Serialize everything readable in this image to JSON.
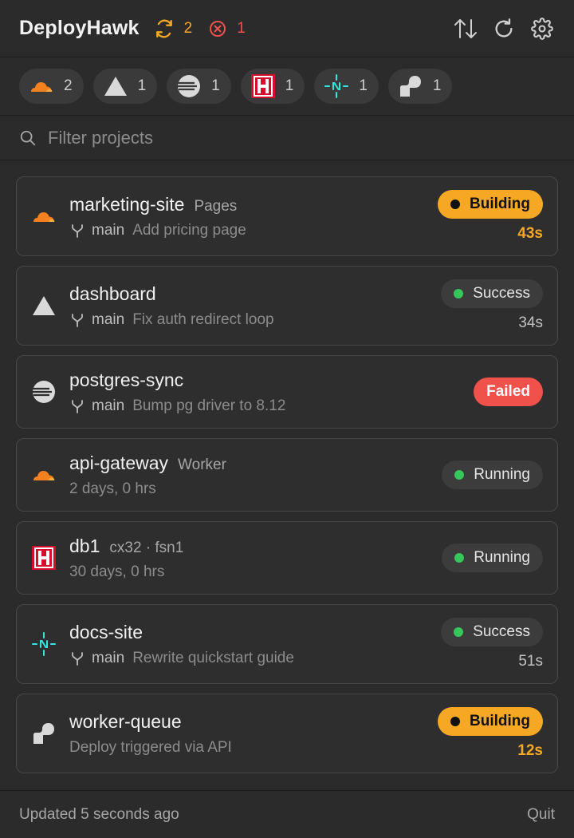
{
  "header": {
    "title": "DeployHawk",
    "building_count": "2",
    "failed_count": "1",
    "icons": [
      "sync-icon",
      "failed-icon",
      "sort-icon",
      "refresh-icon",
      "gear-icon"
    ]
  },
  "providers": [
    {
      "name": "cloudflare",
      "count": "1",
      "color": "#f48120"
    },
    {
      "name": "vercel",
      "count": "1",
      "color": "#d9d9d9"
    },
    {
      "name": "railway",
      "count": "1",
      "color": "#d9d9d9"
    },
    {
      "name": "hetzner",
      "count": "1",
      "color": "#d50c2d"
    },
    {
      "name": "netlify",
      "count": "1",
      "color": "#32e6e2"
    },
    {
      "name": "render",
      "count": "1",
      "color": "#d9d9d9"
    }
  ],
  "provider_counts": [
    "2",
    "1",
    "1",
    "1",
    "1",
    "1"
  ],
  "search": {
    "placeholder": "Filter projects"
  },
  "projects": [
    {
      "name": "marketing-site",
      "tag": "Pages",
      "branch": "main",
      "message": "Add pricing page",
      "status": "Building",
      "duration": "43s"
    },
    {
      "name": "dashboard",
      "tag": "",
      "branch": "main",
      "message": "Fix auth redirect loop",
      "status": "Success",
      "duration": "34s"
    },
    {
      "name": "postgres-sync",
      "tag": "",
      "branch": "main",
      "message": "Bump pg driver to 8.12",
      "status": "Failed",
      "duration": ""
    },
    {
      "name": "api-gateway",
      "tag": "Worker",
      "branch": "",
      "message": "2 days, 0 hrs",
      "status": "Running",
      "duration": ""
    },
    {
      "name": "db1",
      "tag": "cx32 · fsn1",
      "branch": "",
      "message": "30 days, 0 hrs",
      "status": "Running",
      "duration": ""
    },
    {
      "name": "docs-site",
      "tag": "",
      "branch": "main",
      "message": "Rewrite quickstart guide",
      "status": "Success",
      "duration": "51s"
    },
    {
      "name": "worker-queue",
      "tag": "",
      "branch": "",
      "message": "Deploy triggered via API",
      "status": "Building",
      "duration": "12s"
    }
  ],
  "footer": {
    "updated": "Updated 5 seconds ago",
    "quit": "Quit"
  },
  "colors": {
    "building": "#f6a825",
    "success": "#35c759",
    "failed": "#f0514b",
    "background": "#2b2b2b"
  }
}
